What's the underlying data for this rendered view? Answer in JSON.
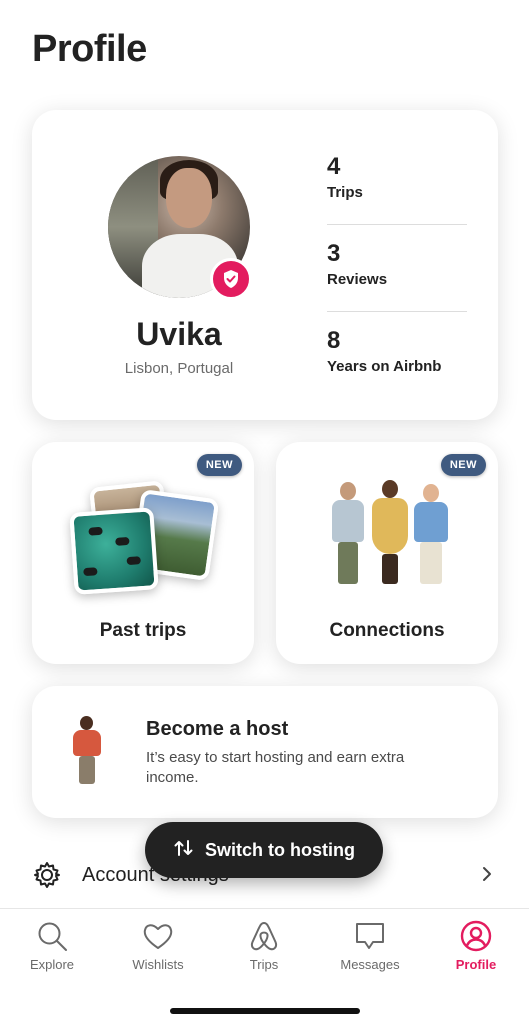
{
  "page": {
    "title": "Profile"
  },
  "profile": {
    "name": "Uvika",
    "location": "Lisbon, Portugal",
    "stats": [
      {
        "value": "4",
        "label": "Trips"
      },
      {
        "value": "3",
        "label": "Reviews"
      },
      {
        "value": "8",
        "label": "Years on Airbnb"
      }
    ]
  },
  "tiles": {
    "past_trips": {
      "label": "Past trips",
      "badge": "NEW"
    },
    "connections": {
      "label": "Connections",
      "badge": "NEW"
    }
  },
  "host": {
    "title": "Become a host",
    "description": "It’s easy to start hosting and earn extra income."
  },
  "account": {
    "label": "Account settings"
  },
  "switch": {
    "label": "Switch to hosting"
  },
  "tabbar": {
    "items": [
      {
        "label": "Explore",
        "icon": "search-icon"
      },
      {
        "label": "Wishlists",
        "icon": "heart-icon"
      },
      {
        "label": "Trips",
        "icon": "airbnb-logo-icon"
      },
      {
        "label": "Messages",
        "icon": "message-icon"
      },
      {
        "label": "Profile",
        "icon": "profile-icon",
        "active": true
      }
    ]
  },
  "colors": {
    "accent": "#E31C5F",
    "badge": "#3f5a80",
    "pill": "#222222"
  }
}
